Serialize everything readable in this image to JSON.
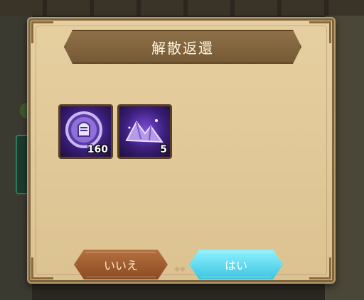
{
  "dialog": {
    "title": "解散返還",
    "items": [
      {
        "icon": "purple-coin-icon",
        "quantity": "160"
      },
      {
        "icon": "purple-crystal-dust-icon",
        "quantity": "5"
      }
    ],
    "buttons": {
      "no_label": "いいえ",
      "yes_label": "はい"
    }
  },
  "colors": {
    "parchment": "#e6cfa0",
    "title_bar": "#7f6340",
    "item_bg": "#4a2596",
    "no_button": "#a05e30",
    "yes_button": "#5ed6ee"
  }
}
